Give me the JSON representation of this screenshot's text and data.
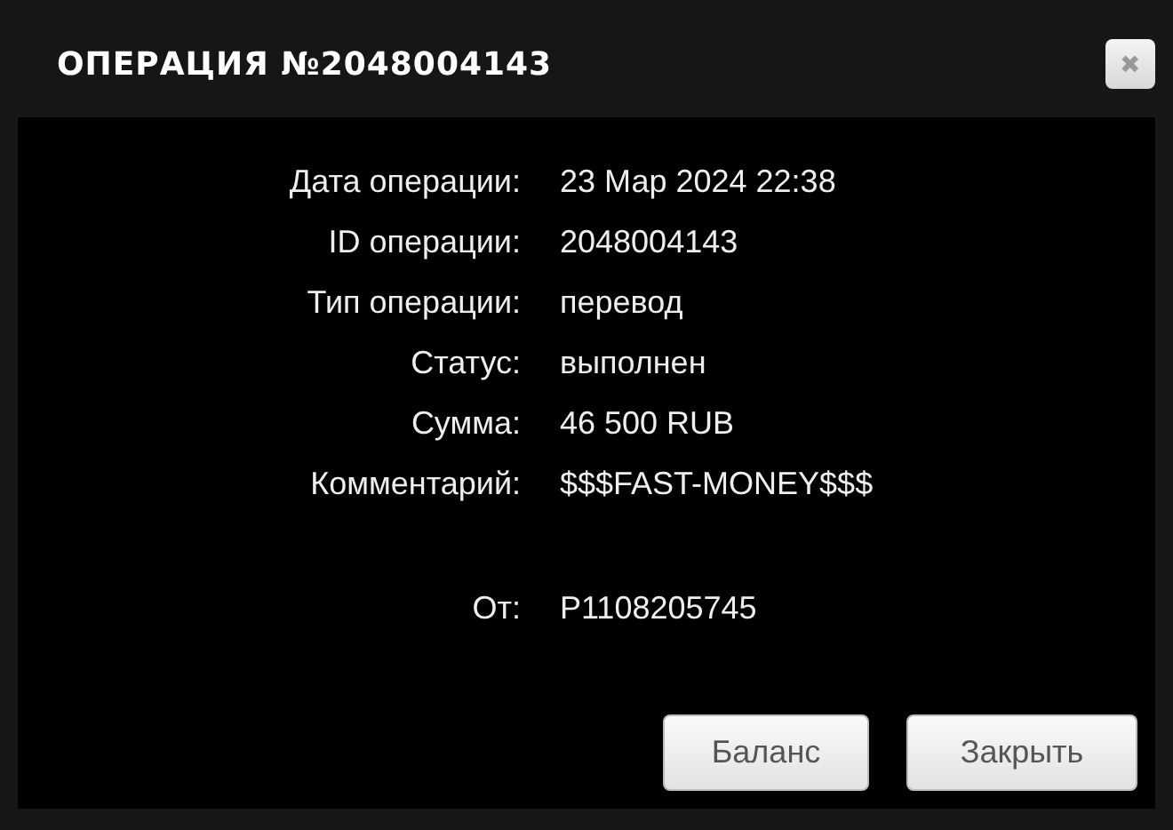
{
  "dialog": {
    "title": "ОПЕРАЦИЯ №2048004143",
    "close_icon": "✖"
  },
  "rows": [
    {
      "label": "Дата операции:",
      "value": "23 Мар 2024 22:38"
    },
    {
      "label": "ID операции:",
      "value": "2048004143"
    },
    {
      "label": "Тип операции:",
      "value": "перевод"
    },
    {
      "label": "Статус:",
      "value": "выполнен"
    },
    {
      "label": "Сумма:",
      "value": "46 500 RUB"
    },
    {
      "label": "Комментарий:",
      "value": "$$$FAST-MONEY$$$"
    }
  ],
  "sender": {
    "label": "От:",
    "value": "P1108205745"
  },
  "buttons": [
    "Баланс",
    "Закрыть"
  ]
}
